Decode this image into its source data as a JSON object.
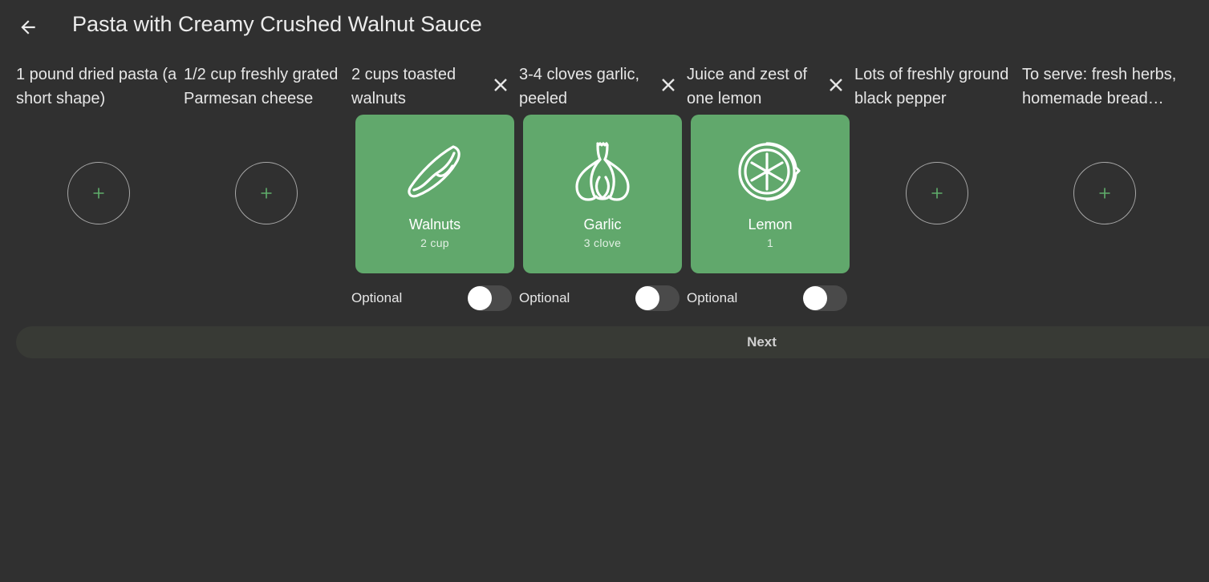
{
  "header": {
    "title": "Pasta with Creamy Crushed Walnut Sauce",
    "back_icon": "arrow-left-icon"
  },
  "ingredients": [
    {
      "label": "1 pound dried pasta (a short shape)",
      "selected": false
    },
    {
      "label": "1/2 cup freshly grated Parmesan cheese",
      "selected": false
    },
    {
      "label": "2 cups toasted walnuts",
      "selected": true,
      "food_name": "Walnuts",
      "quantity": "2 cup",
      "icon": "walnut-icon",
      "optional_label": "Optional",
      "optional": false
    },
    {
      "label": "3-4 cloves garlic, peeled",
      "selected": true,
      "food_name": "Garlic",
      "quantity": "3 clove",
      "icon": "garlic-icon",
      "optional_label": "Optional",
      "optional": false
    },
    {
      "label": "Juice and zest of one lemon",
      "selected": true,
      "food_name": "Lemon",
      "quantity": "1",
      "icon": "lemon-icon",
      "optional_label": "Optional",
      "optional": false
    },
    {
      "label": "Lots of freshly ground black pepper",
      "selected": false
    },
    {
      "label": "To serve: fresh herbs, homemade bread crumbs",
      "selected": false
    }
  ],
  "footer": {
    "next_label": "Next"
  },
  "colors": {
    "background": "#303030",
    "card": "#61a86c",
    "accent_plus": "#5fae6b",
    "next_bar": "#383a35"
  }
}
